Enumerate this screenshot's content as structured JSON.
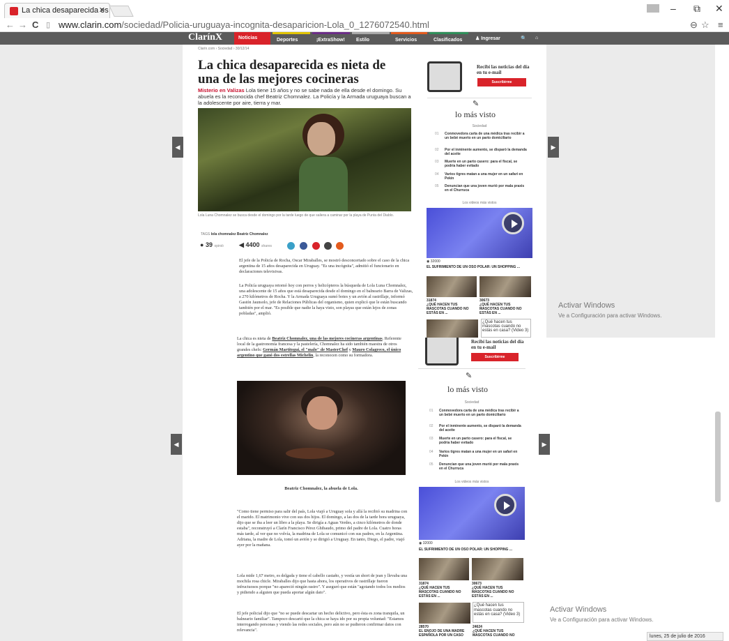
{
  "browser": {
    "tab_title": "La chica desaparecida es",
    "url_host": "www.clarin.com",
    "url_path": "/sociedad/Policia-uruguaya-incognita-desaparicion-Lola_0_1276072540.html"
  },
  "site": {
    "logo": "ClarínX",
    "menu": [
      "Noticias",
      "Deportes",
      "¡ExtraShow!",
      "Estilo",
      "Servicios",
      "Clasificados",
      "Ingresar"
    ],
    "breadcrumb": "Clarín.com › Sociedad › 30/12/14"
  },
  "article": {
    "title": "La chica desaparecida es nieta de una de las mejores cocineras",
    "lead_kicker": "Misterio en Valizas",
    "lead_text": "Lola tiene 15 años y no se sabe nada de ella desde el domingo. Su abuela es la reconocida chef Beatriz Chomnalez. La Policía y la Armada uruguaya buscan a la adolescente por aire, tierra y mar.",
    "photo_caption": "Lola Luna Chomnalez se busca desde el domingo por la tarde luego de que saliera a caminar por la playa de Punta del Diablo.",
    "tags_label": "TAGS",
    "tags": "lola chomnalez   Beatriz Chomnalez",
    "comments": "39",
    "comments_label": "opinió",
    "shares": "4400",
    "shares_label": "shares",
    "p1": "El jefe de la Policía de Rocha, Oscar Miraballes, se mostró desconcertado sobre el caso de la chica argentina de 15 años desaparecida en Uruguay. \"Es una incógnita\", admitió el funcionario en declaraciones televisivas.",
    "p2": "La Policía uruguaya retomó hoy con perros y helicópteros la búsqueda de Lola Luna Chomnalez, una adolescente de 15 años que está desaparecida desde el domingo en el balneario Barra de Valizas, a 270 kilómetros de Rocha. Y la Armada Uruguaya sumó botes y un avión al rastrillaje, informó Gastón Jaunsolo, jefe de Relaciones Públicas del organismo, quien explicó que le están buscando también por el mar. \"Es posible que nadie la haya visto, son playas que están lejos de zonas pobladas\", amplió.",
    "p3a": "La chica es nieta de ",
    "p3b": "Beatriz Chomnalez, una de las mejores cocineras argentinas",
    "p3c": ". Referente local de la gastronomía francesa y la pastelería, Chomnalez ha sido también maestra de otros grandes chefs: ",
    "p3d": "Germán Martitegui, el \"malo\" de MasterChef",
    "p3e": " y ",
    "p3f": "Mauro Colagreco, el único argentino que ganó dos estrellas Michelin",
    "p3g": ", la reconocen como su formadora.",
    "photo2_caption": "Beatriz Chomnalez, la abuela de Lola.",
    "p4": "\"Como tiene permiso para salir del país, Lola viajó a Uruguay sola y allá la recibió su madrina con el marido. El matrimonio vive con sus dos hijos. El domingo, a las dos de la tarde hora uruguaya, dijo que se iba a leer un libro a la playa. Se dirigía a Aguas Verdes, a cinco kilómetros de donde estaba\", reconstruyó a Clarín Francisco Pérez Ghibaudo, primo del padre de Lola. Cuatro horas más tarde, al ver que no volvía, la madrina de Lola se comunicó con sus padres, en la Argentina. Adriana, la madre de Lola, tomó un avión y se dirigió a Uruguay. En tanto, Diego, el padre, viajó ayer por la mañana.",
    "p5": "Lola mide 1,67 metro, es delgada y tiene el cabello castaño, y vestía un short de jean y llevaba una mochila rosa chicle. Miraballes dijo que hasta ahora, los operativos de rastrillaje fueron infructuosos porque \"no apareció ningún rastro\". Y aseguró que están \"agotando todos los medios y pidiendo a alguien que pueda aportar algún dato\".",
    "p6": "El jefe policial dijo que \"no se puede descartar un hecho delictivo, pero ésta es zona tranquila, un balneario familiar\". Tampoco descartó que la chica se haya ido por su propia voluntad: \"Estamos interrogando personas y viendo las redes sociales, pero aún no se pudieron confirmar datos con relevancia\"."
  },
  "sidebar": {
    "newsletter": "Recibí las noticias del día en tu e-mail",
    "subscribe": "Suscribirme",
    "most_viewed": "lo más visto",
    "section": "Sociedad",
    "items": [
      {
        "n": "01",
        "t": "Conmovedora carta de una médica tras recibir a un bebé muerto en un parto domiciliario"
      },
      {
        "n": "02",
        "t": "Por el inminente aumento, se disparó la demanda del aceite"
      },
      {
        "n": "03",
        "t": "Muerte en un parto casero: para el fiscal, se podría haber evitado"
      },
      {
        "n": "04",
        "t": "Varios tigres matan a una mujer en un safari en Pekín"
      },
      {
        "n": "05",
        "t": "Denuncian que una joven murió por mala praxis en el Churruca"
      }
    ],
    "videos_label": "Los videos más vistos",
    "video_views": "32000",
    "video_title": "EL SUFRIMIENTO DE UN OSO POLAR: UN SHOPPING ...",
    "v1_views": "31874",
    "v1_title": "¿QUÉ HACEN TUS MASCOTAS CUANDO NO ESTÁS EN ...",
    "v2_views": "30673",
    "v2_title": "¿QUÉ HACEN TUS MASCOTAS CUANDO NO ESTÁS EN ...",
    "v3_caption": "¿Qué hacen tus mascotas cuando no estás en casa? (Video 3)",
    "v4_views": "28570",
    "v4_title": "EL ENOJO DE UNA MADRE ESPAÑOLA POR UN CASO",
    "v5_views": "24624",
    "v5_title": "¿QUÉ HACEN TUS MASCOTAS CUANDO NO"
  },
  "windows": {
    "activate_title": "Activar Windows",
    "activate_sub": "Ve a Configuración para activar Windows.",
    "date": "lunes, 25 de julio de 2016"
  },
  "colors": {
    "accent": "#d9232a",
    "sitebar": "#5b5b5b",
    "menu_colors": [
      "#d9232a",
      "#3b7a3b",
      "#6b2d87",
      "#8e8e8e",
      "#e35b1e",
      "#2f8f5a",
      "#5b5b5b"
    ]
  }
}
